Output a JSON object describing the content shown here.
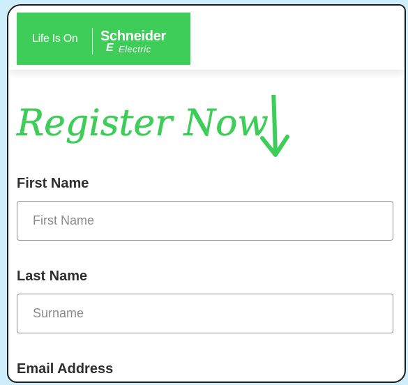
{
  "header": {
    "tagline": "Life Is On",
    "brand_name": "Schneider",
    "brand_sub": "Electric",
    "brand_mark": "E",
    "brand_color": "#3dcd58"
  },
  "headline": {
    "text": "Register Now",
    "color": "#3dcd58",
    "icon": "arrow-down-icon"
  },
  "form": {
    "first_name": {
      "label": "First Name",
      "placeholder": "First Name",
      "value": ""
    },
    "last_name": {
      "label": "Last Name",
      "placeholder": "Surname",
      "value": ""
    },
    "email": {
      "label": "Email Address"
    }
  }
}
